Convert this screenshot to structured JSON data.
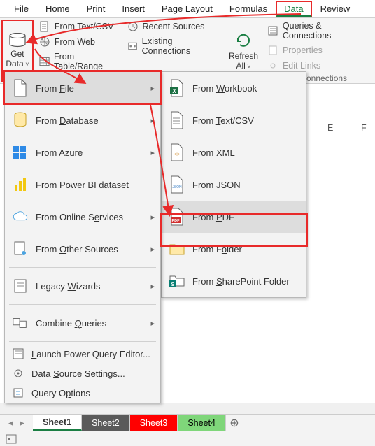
{
  "tabs": {
    "file": "File",
    "home": "Home",
    "print": "Print",
    "insert": "Insert",
    "page_layout": "Page Layout",
    "formulas": "Formulas",
    "data": "Data",
    "review": "Review"
  },
  "ribbon": {
    "get_data_line1": "Get",
    "get_data_line2": "Data",
    "from_text_csv": "From Text/CSV",
    "from_web": "From Web",
    "from_table_range": "From Table/Range",
    "recent_sources": "Recent Sources",
    "existing_connections": "Existing Connections",
    "refresh_line1": "Refresh",
    "refresh_line2": "All",
    "queries_connections": "Queries & Connections",
    "properties": "Properties",
    "edit_links": "Edit Links",
    "connections_frag": "onnections"
  },
  "menu1": {
    "from_file": "From File",
    "from_database": "From Database",
    "from_azure": "From Azure",
    "from_power_bi": "From Power BI dataset",
    "from_online": "From Online Services",
    "from_other": "From Other Sources",
    "legacy_wizards": "Legacy Wizards",
    "combine_queries": "Combine Queries",
    "launch_pq": "Launch Power Query Editor...",
    "data_source_settings": "Data Source Settings...",
    "query_options": "Query Options"
  },
  "menu2": {
    "from_workbook": "From Workbook",
    "from_text_csv": "From Text/CSV",
    "from_xml": "From XML",
    "from_json": "From JSON",
    "from_pdf": "From PDF",
    "from_folder": "From Folder",
    "from_sharepoint": "From SharePoint Folder"
  },
  "columns": {
    "E": "E",
    "F": "F"
  },
  "sheets": {
    "s1": "Sheet1",
    "s2": "Sheet2",
    "s3": "Sheet3",
    "s4": "Sheet4"
  }
}
